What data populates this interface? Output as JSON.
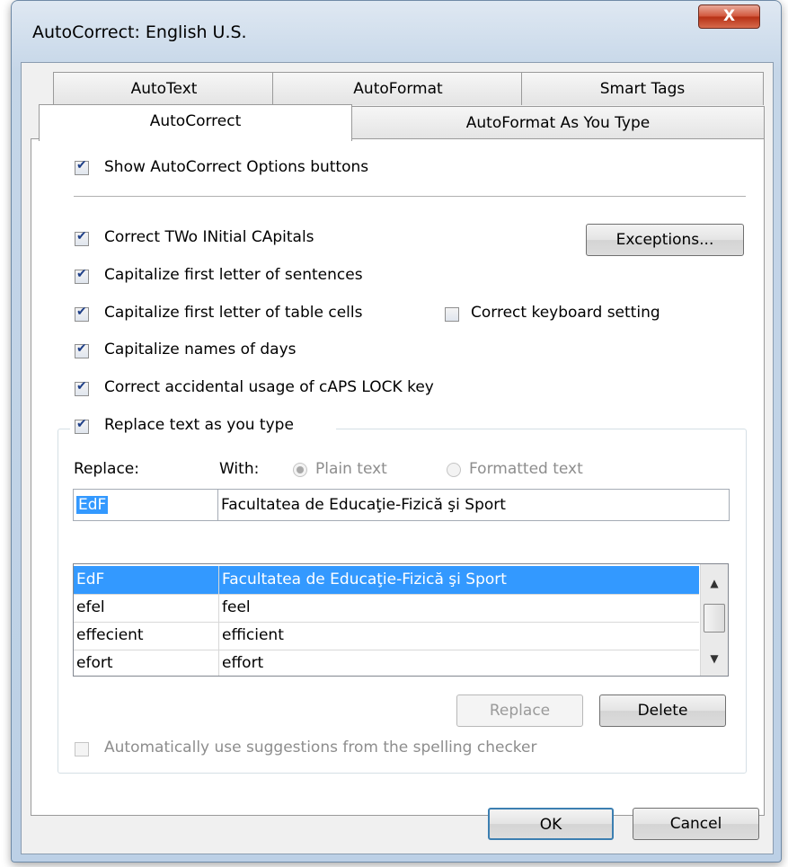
{
  "window": {
    "title": "AutoCorrect: English U.S.",
    "close_glyph": "X"
  },
  "tabs": {
    "back": [
      "AutoText",
      "AutoFormat",
      "Smart Tags"
    ],
    "front": [
      "AutoCorrect",
      "AutoFormat As You Type"
    ]
  },
  "options": {
    "show_buttons": "Show AutoCorrect Options buttons",
    "two_initials": "Correct TWo INitial CApitals",
    "cap_sentences": "Capitalize first letter of sentences",
    "cap_table_cells": "Capitalize first letter of table cells",
    "cap_days": "Capitalize names of days",
    "caps_lock": "Correct accidental usage of cAPS LOCK key",
    "keyboard_setting": "Correct keyboard setting",
    "replace_as_type": "Replace text as you type",
    "suggestions": "Automatically use suggestions from the spelling checker"
  },
  "buttons": {
    "exceptions": "Exceptions...",
    "replace": "Replace",
    "delete": "Delete",
    "ok": "OK",
    "cancel": "Cancel"
  },
  "replace_section": {
    "replace_label": "Replace:",
    "with_label": "With:",
    "plain_text": "Plain text",
    "formatted_text": "Formatted text",
    "replace_value": "EdF",
    "with_value": "Facultatea de Educaţie-Fizică şi Sport"
  },
  "entries": [
    {
      "replace": "EdF",
      "with": "Facultatea de Educaţie-Fizică şi Sport"
    },
    {
      "replace": "efel",
      "with": "feel"
    },
    {
      "replace": "effecient",
      "with": "efficient"
    },
    {
      "replace": "efort",
      "with": "effort"
    }
  ],
  "colors": {
    "selection": "#3399ff",
    "close_button": "#c8462b"
  }
}
